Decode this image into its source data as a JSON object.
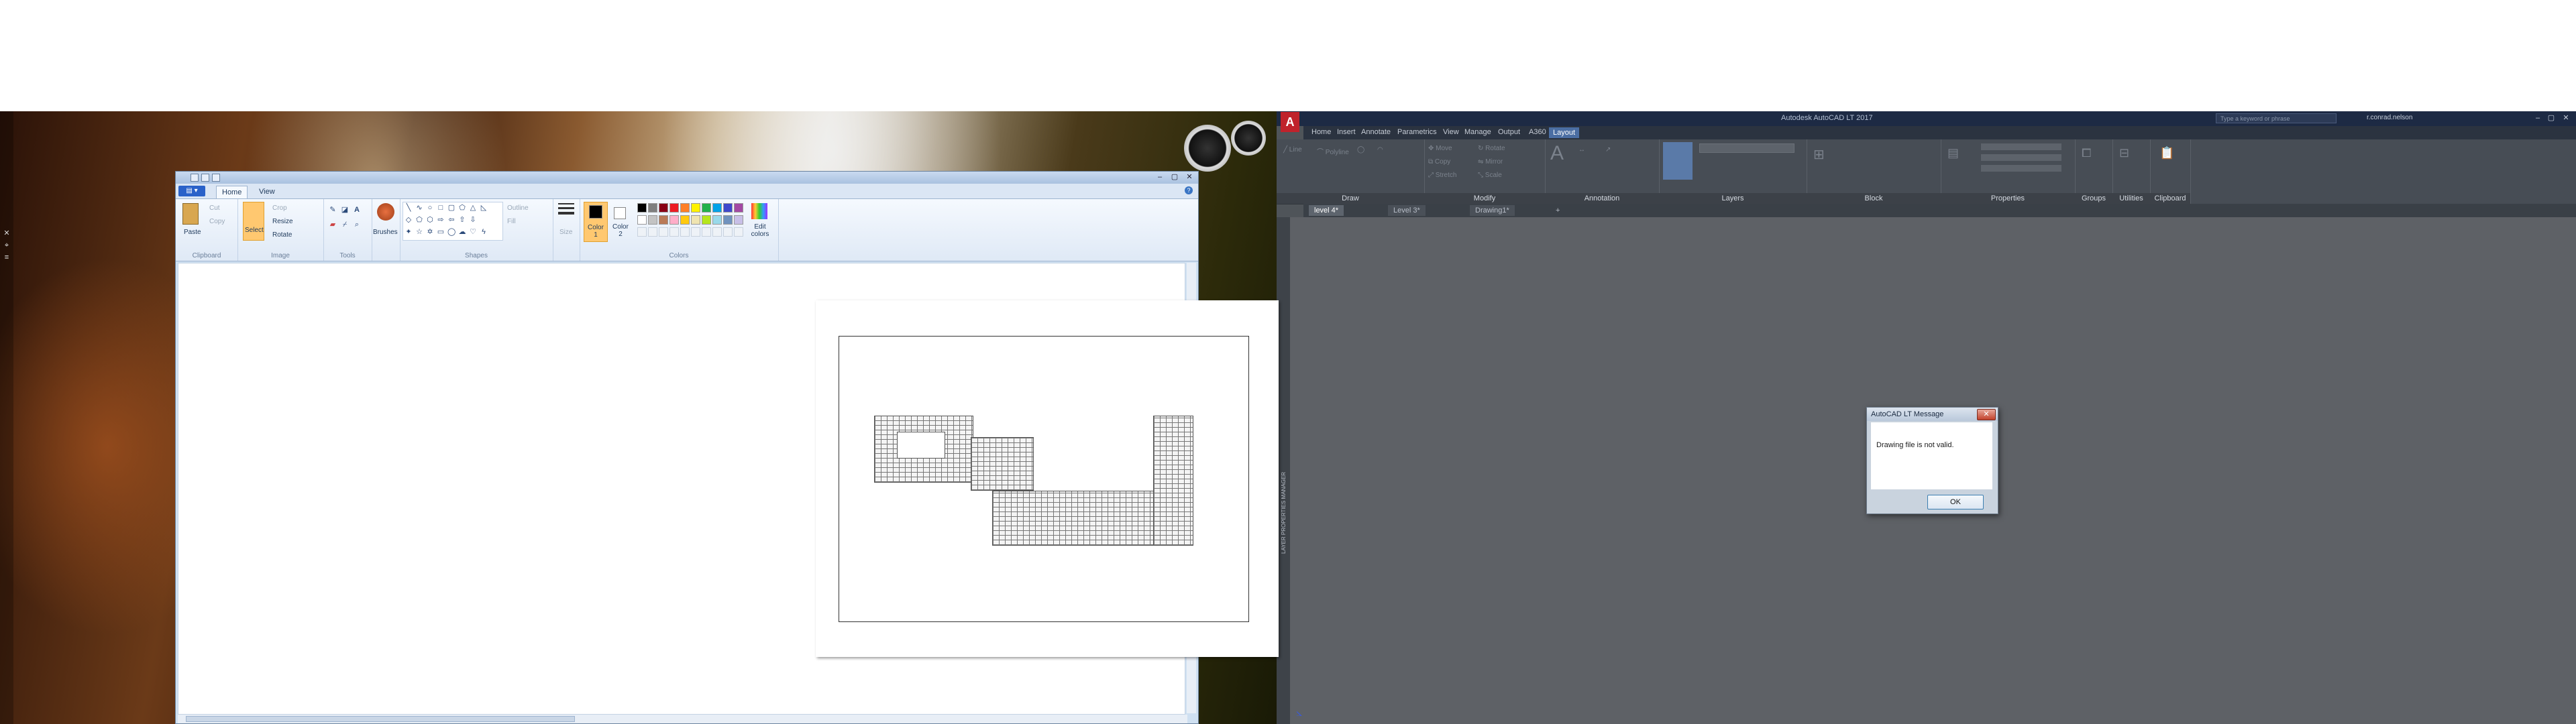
{
  "paint": {
    "tabs": [
      "Home",
      "View"
    ],
    "clipboard": {
      "paste": "Paste",
      "cut": "Cut",
      "copy": "Copy",
      "group": "Clipboard"
    },
    "image": {
      "select": "Select",
      "crop": "Crop",
      "resize": "Resize",
      "rotate": "Rotate",
      "group": "Image"
    },
    "tools": {
      "group": "Tools",
      "brushes": "Brushes"
    },
    "shapes": {
      "outline": "Outline",
      "fill": "Fill",
      "group": "Shapes"
    },
    "size": "Size",
    "colors": {
      "color1": "Color 1",
      "color2": "Color 2",
      "edit": "Edit colors",
      "group": "Colors",
      "palette_row1": [
        "#000000",
        "#7f7f7f",
        "#880015",
        "#ed1c24",
        "#ff7f27",
        "#fff200",
        "#22b14c",
        "#00a2e8",
        "#3f48cc",
        "#a349a4"
      ],
      "palette_row2": [
        "#ffffff",
        "#c3c3c3",
        "#b97a57",
        "#ffaec9",
        "#ffc90e",
        "#efe4b0",
        "#b5e61d",
        "#99d9ea",
        "#7092be",
        "#c8bfe7"
      ]
    }
  },
  "acad": {
    "logo": "A",
    "title": "Autodesk AutoCAD LT 2017",
    "search_placeholder": "Type a keyword or phrase",
    "user": "r.conrad.nelson",
    "tabs": [
      "Home",
      "Insert",
      "Annotate",
      "Parametrics",
      "View",
      "Manage",
      "Output",
      "A360",
      "Layout"
    ],
    "panels": [
      "Draw",
      "Modify",
      "Annotation",
      "Layers",
      "Block",
      "Properties",
      "Groups",
      "Utilities",
      "Clipboard"
    ],
    "doc_tabs": [
      "level 4*",
      "Level 3*",
      "Drawing1*"
    ],
    "palette_label": "LAYER PROPERTIES MANAGER"
  },
  "dialog": {
    "title": "AutoCAD LT Message",
    "message": "Drawing file is not valid.",
    "ok_label": "OK"
  }
}
